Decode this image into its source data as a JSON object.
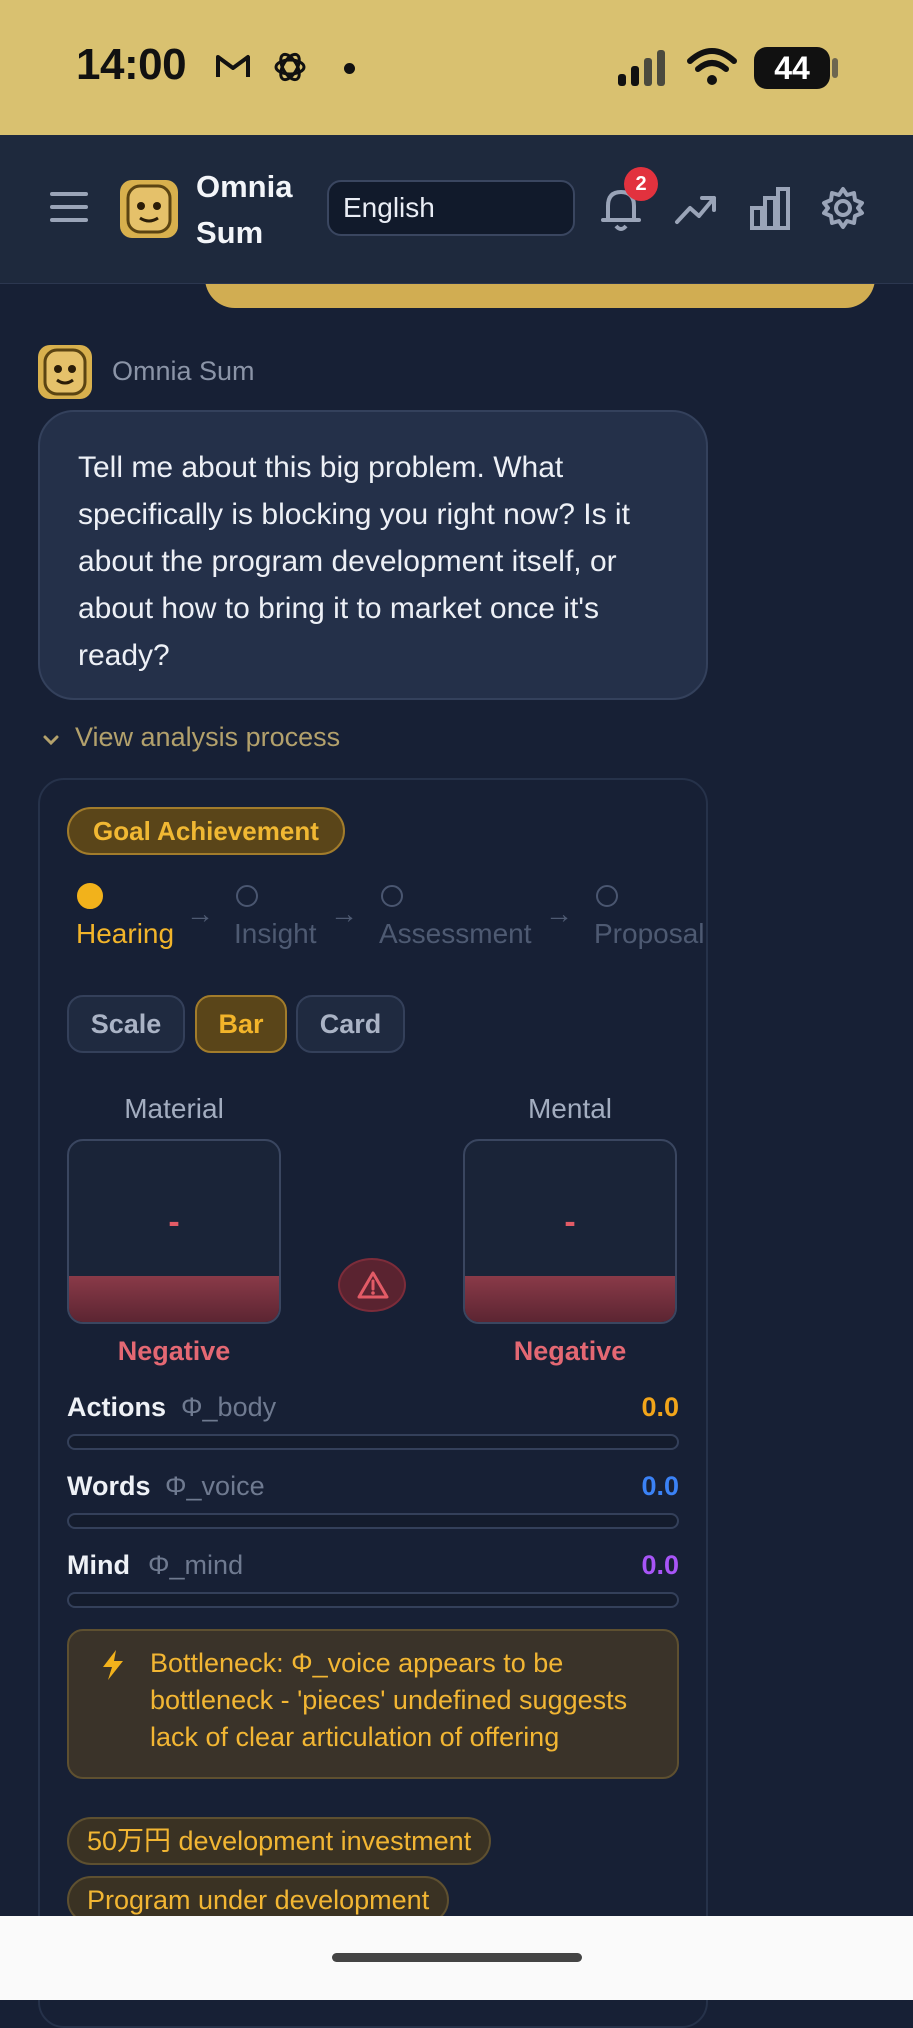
{
  "status_bar": {
    "time": "14:00",
    "battery": "44",
    "icons": [
      "gmail-icon",
      "openai-icon",
      "dot-icon",
      "signal-icon",
      "wifi-icon",
      "battery-icon"
    ]
  },
  "header": {
    "app_name": "Omnia Sum",
    "language": "English",
    "notification_count": "2",
    "icons": [
      "menu-icon",
      "bell-icon",
      "trend-icon",
      "bar-chart-icon",
      "gear-icon"
    ]
  },
  "chat": {
    "sender": "Omnia Sum",
    "message": "Tell me about this big problem. What specifically is blocking you right now? Is it about the program development itself, or about how to bring it to market once it's ready?",
    "view_analysis_label": "View analysis process"
  },
  "analysis": {
    "goal_label": "Goal Achievement",
    "steps": [
      {
        "label": "Hearing",
        "active": true
      },
      {
        "label": "Insight",
        "active": false
      },
      {
        "label": "Assessment",
        "active": false
      },
      {
        "label": "Proposal",
        "active": false
      }
    ],
    "view_tabs": [
      {
        "label": "Scale",
        "active": false
      },
      {
        "label": "Bar",
        "active": true
      },
      {
        "label": "Card",
        "active": false
      }
    ],
    "gauges": [
      {
        "title": "Material",
        "value": "-",
        "status": "Negative"
      },
      {
        "title": "Mental",
        "value": "-",
        "status": "Negative"
      }
    ],
    "metrics": [
      {
        "name": "Actions",
        "symbol": "Φ_body",
        "value": "0.0",
        "color": "#f2a51a"
      },
      {
        "name": "Words",
        "symbol": "Φ_voice",
        "value": "0.0",
        "color": "#3b82f6"
      },
      {
        "name": "Mind",
        "symbol": "Φ_mind",
        "value": "0.0",
        "color": "#a855f7"
      }
    ],
    "bottleneck": "Bottleneck: Φ_voice appears to be bottleneck - 'pieces' undefined suggests lack of clear articulation of offering",
    "tags": [
      "50万円 development investment",
      "Program under development"
    ]
  },
  "colors": {
    "accent": "#f2b21b",
    "negative": "#e46873",
    "background": "#172035",
    "status_bar": "#d9c170"
  }
}
